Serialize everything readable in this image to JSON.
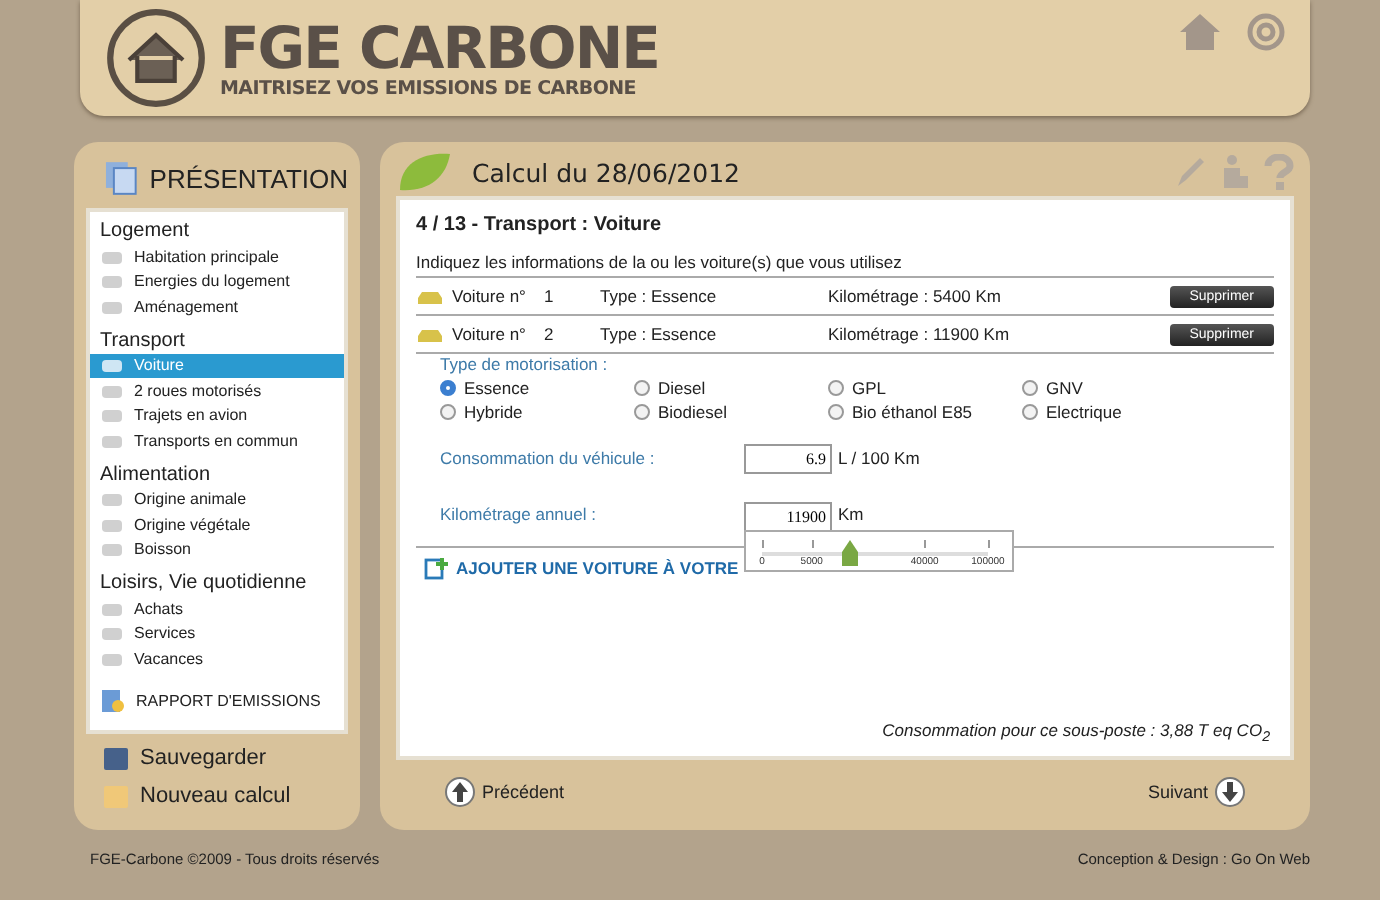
{
  "header": {
    "title": "FGE CARBONE",
    "subtitle": "MAITRISEZ VOS EMISSIONS DE CARBONE"
  },
  "sidebar": {
    "title": "PRÉSENTATION",
    "groups": [
      {
        "label": "Logement",
        "items": [
          {
            "label": "Habitation principale",
            "selected": false
          },
          {
            "label": "Energies du logement",
            "selected": false
          },
          {
            "label": "Aménagement",
            "selected": false
          }
        ]
      },
      {
        "label": "Transport",
        "items": [
          {
            "label": "Voiture",
            "selected": true
          },
          {
            "label": "2 roues motorisés",
            "selected": false
          },
          {
            "label": "Trajets en avion",
            "selected": false
          },
          {
            "label": "Transports en commun",
            "selected": false
          }
        ]
      },
      {
        "label": "Alimentation",
        "items": [
          {
            "label": "Origine animale",
            "selected": false
          },
          {
            "label": "Origine végétale",
            "selected": false
          },
          {
            "label": "Boisson",
            "selected": false
          }
        ]
      },
      {
        "label": "Loisirs, Vie quotidienne",
        "items": [
          {
            "label": "Achats",
            "selected": false
          },
          {
            "label": "Services",
            "selected": false
          },
          {
            "label": "Vacances",
            "selected": false
          }
        ]
      }
    ],
    "report": "RAPPORT D'EMISSIONS",
    "actions": [
      "Sauvegarder",
      "Nouveau calcul"
    ]
  },
  "main": {
    "title": "Calcul du 28/06/2012",
    "heading": "4 / 13 - Transport : Voiture",
    "instruction": "Indiquez les informations de la ou les voiture(s) que vous utilisez",
    "cars": [
      {
        "name": "Voiture n°",
        "number": "1",
        "type": "Type : Essence",
        "mileage": "Kilométrage : 5400 Km",
        "button": "Supprimer"
      },
      {
        "name": "Voiture n°",
        "number": "2",
        "type": "Type : Essence",
        "mileage": "Kilométrage : 11900 Km",
        "button": "Supprimer"
      }
    ],
    "motorisation": {
      "label": "Type de motorisation :",
      "options": [
        {
          "label": "Essence",
          "selected": true
        },
        {
          "label": "Diesel",
          "selected": false
        },
        {
          "label": "GPL",
          "selected": false
        },
        {
          "label": "GNV",
          "selected": false
        },
        {
          "label": "Hybride",
          "selected": false
        },
        {
          "label": "Biodiesel",
          "selected": false
        },
        {
          "label": "Bio éthanol E85",
          "selected": false
        },
        {
          "label": "Electrique",
          "selected": false
        }
      ]
    },
    "consumption": {
      "label": "Consommation du véhicule :",
      "value": "6.9",
      "unit": "L / 100 Km"
    },
    "annual": {
      "label": "Kilométrage annuel :",
      "value": "11900",
      "unit": "Km"
    },
    "slider": {
      "level": 0.39,
      "ticks": [
        "0",
        "5000",
        "40000",
        "100000"
      ]
    },
    "add_link": "AJOUTER UNE VOITURE À VOTRE",
    "total": "Consommation pour ce sous-poste : 3,88 T eq CO$_{2}$",
    "prev": "Précédent",
    "next": "Suivant"
  },
  "footer": {
    "left": "FGE-Carbone ©2009 - Tous droits réservés",
    "right": "Conception & Design : Go On Web"
  }
}
